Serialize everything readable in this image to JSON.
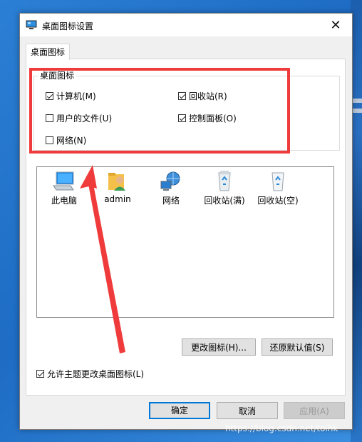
{
  "window": {
    "title": "桌面图标设置",
    "close_glyph": "✕"
  },
  "tabs": [
    {
      "label": "桌面图标"
    }
  ],
  "group": {
    "legend": "桌面图标",
    "options": [
      {
        "label": "计算机(M)",
        "checked": true
      },
      {
        "label": "回收站(R)",
        "checked": true
      },
      {
        "label": "用户的文件(U)",
        "checked": false
      },
      {
        "label": "控制面板(O)",
        "checked": true
      },
      {
        "label": "网络(N)",
        "checked": false
      }
    ]
  },
  "icons": [
    {
      "label": "此电脑",
      "icon": "computer-icon"
    },
    {
      "label": "admin",
      "icon": "user-folder-icon"
    },
    {
      "label": "网络",
      "icon": "network-icon"
    },
    {
      "label": "回收站(满)",
      "icon": "recycle-bin-full-icon"
    },
    {
      "label": "回收站(空)",
      "icon": "recycle-bin-empty-icon"
    }
  ],
  "buttons": {
    "change_icon": "更改图标(H)...",
    "restore_default": "还原默认值(S)",
    "ok": "确定",
    "cancel": "取消",
    "apply": "应用(A)"
  },
  "allow_theme": {
    "label": "允许主题更改桌面图标(L)",
    "checked": true
  },
  "annotation": {
    "color": "#ef3b3b"
  },
  "watermark": "https://blog.csdn.net/tolhk"
}
